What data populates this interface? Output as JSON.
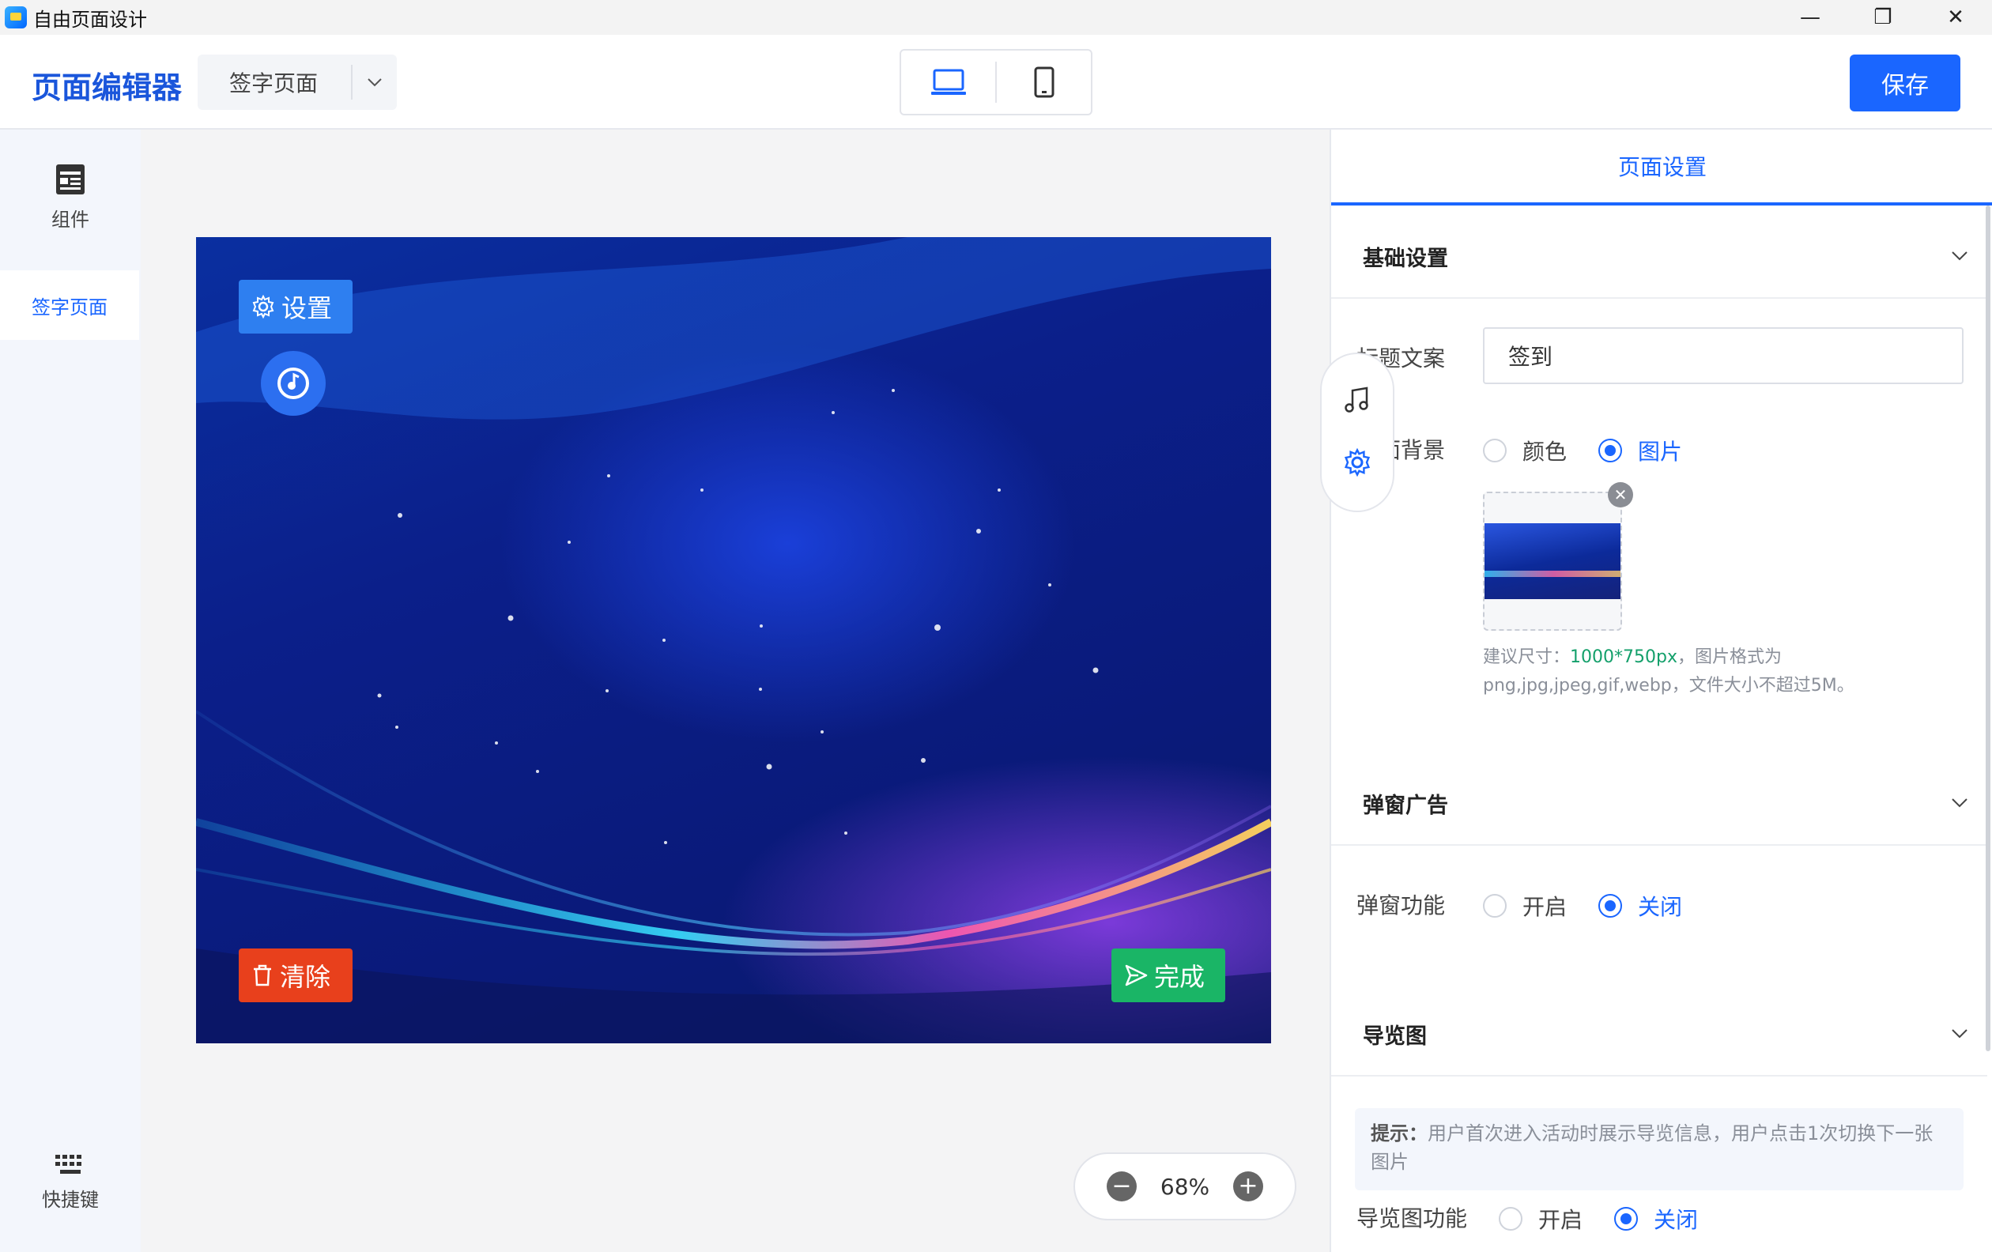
{
  "window": {
    "title": "自由页面设计",
    "minimize_glyph": "—",
    "restore_glyph": "❐",
    "close_glyph": "✕"
  },
  "header": {
    "brand": "页面编辑器",
    "page_select": "签字页面",
    "save_label": "保存"
  },
  "sidebar": {
    "components_label": "组件",
    "active_page": "签字页面",
    "shortcuts_label": "快捷键"
  },
  "stage": {
    "settings_label": "设置",
    "clear_label": "清除",
    "done_label": "完成"
  },
  "zoom": {
    "value": "68%",
    "minus": "−",
    "plus": "+"
  },
  "panel": {
    "tab": "页面设置",
    "basic": {
      "title": "基础设置",
      "title_text_label": "标题文案",
      "title_text_value": "签到",
      "background_label": "页面背景",
      "bg_options": [
        "颜色",
        "图片"
      ],
      "bg_selected": "图片",
      "remove_glyph": "✕",
      "hint_prefix": "建议尺寸：",
      "hint_size": "1000*750px",
      "hint_suffix": "，图片格式为png,jpg,jpeg,gif,webp，文件大小不超过5M。"
    },
    "popup": {
      "title": "弹窗广告",
      "feature_label": "弹窗功能",
      "options": [
        "开启",
        "关闭"
      ],
      "selected": "关闭"
    },
    "guide": {
      "title": "导览图",
      "tip_bold": "提示：",
      "tip_text": "用户首次进入活动时展示导览信息，用户点击1次切换下一张图片",
      "feature_label": "导览图功能",
      "options": [
        "开启",
        "关闭"
      ],
      "selected": "关闭"
    }
  },
  "colors": {
    "accent": "#1a66ff",
    "clear": "#e8401c",
    "done": "#1ab566",
    "settings": "#2e7ff0"
  }
}
